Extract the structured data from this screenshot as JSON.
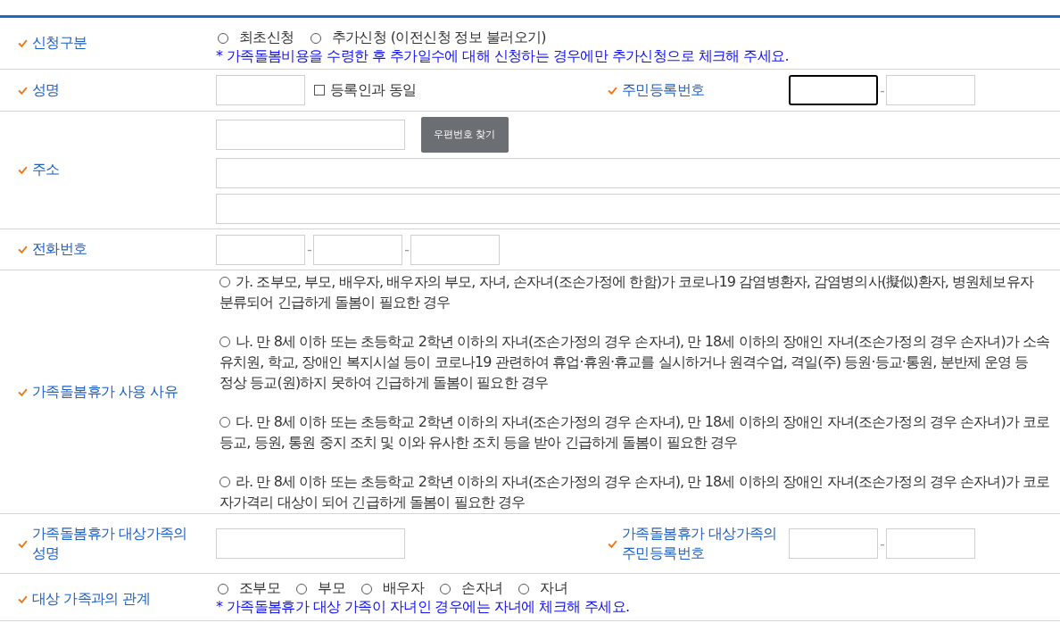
{
  "application_type": {
    "label": "신청구분",
    "options": [
      {
        "label": "최초신청",
        "selected": false
      },
      {
        "label": "추가신청 (이전신청 정보 불러오기)",
        "selected": false
      }
    ],
    "note": "* 가족돌봄비용을 수령한 후 추가일수에 대해 신청하는 경우에만 추가신청으로 체크해 주세요."
  },
  "name": {
    "label": "성명",
    "same_as_registrant": {
      "label": "등록인과 동일",
      "checked": false
    },
    "rrn_label": "주민등록번호",
    "rrn_fields": [
      {
        "focused": true
      },
      {
        "focused": false
      }
    ],
    "rrn_separator": "-"
  },
  "address": {
    "label": "주소",
    "postcode_button": "우편번호 찾기"
  },
  "phone": {
    "label": "전화번호",
    "separators": [
      "-",
      "-"
    ]
  },
  "reason": {
    "label": "가족돌봄휴가 사용 사유",
    "options": [
      {
        "selected": false,
        "lines": [
          "가. 조부모, 부모, 배우자, 배우자의 부모, 자녀, 손자녀(조손가정에 한함)가 코로나19 감염병환자, 감염병의사(擬似)환자, 병원체보유자",
          "분류되어 긴급하게 돌봄이 필요한 경우"
        ]
      },
      {
        "selected": false,
        "lines": [
          "나. 만 8세 이하 또는 초등학교 2학년 이하의 자녀(조손가정의 경우 손자녀), 만 18세 이하의 장애인 자녀(조손가정의 경우 손자녀)가 소속",
          "유치원, 학교, 장애인 복지시설 등이 코로나19 관련하여 휴업·휴원·휴교를 실시하거나 원격수업, 격일(주) 등원·등교·통원, 분반제 운영 등",
          "정상 등교(원)하지 못하여 긴급하게 돌봄이 필요한 경우"
        ]
      },
      {
        "selected": false,
        "lines": [
          "다. 만 8세 이하 또는 초등학교 2학년 이하의 자녀(조손가정의 경우 손자녀), 만 18세 이하의 장애인 자녀(조손가정의 경우 손자녀)가 코로",
          "등교, 등원, 통원 중지 조치 및 이와 유사한 조치 등을 받아 긴급하게 돌봄이 필요한 경우"
        ]
      },
      {
        "selected": false,
        "lines": [
          "라. 만 8세 이하 또는 초등학교 2학년 이하의 자녀(조손가정의 경우 손자녀), 만 18세 이하의 장애인 자녀(조손가정의 경우 손자녀)가 코로",
          "자가격리 대상이 되어 긴급하게 돌봄이 필요한 경우"
        ]
      }
    ]
  },
  "family_member": {
    "name_label": "가족돌봄휴가 대상가족의 성명",
    "rrn_label": "가족돌봄휴가 대상가족의 주민등록번호",
    "rrn_separator": "-"
  },
  "relationship": {
    "label": "대상 가족과의 관계",
    "options": [
      {
        "label": "조부모",
        "selected": false
      },
      {
        "label": "부모",
        "selected": false
      },
      {
        "label": "배우자",
        "selected": false
      },
      {
        "label": "손자녀",
        "selected": false
      },
      {
        "label": "자녀",
        "selected": false
      }
    ],
    "note": "* 가족돌봄휴가 대상 가족이 자녀인 경우에는 자녀에 체크해 주세요."
  }
}
